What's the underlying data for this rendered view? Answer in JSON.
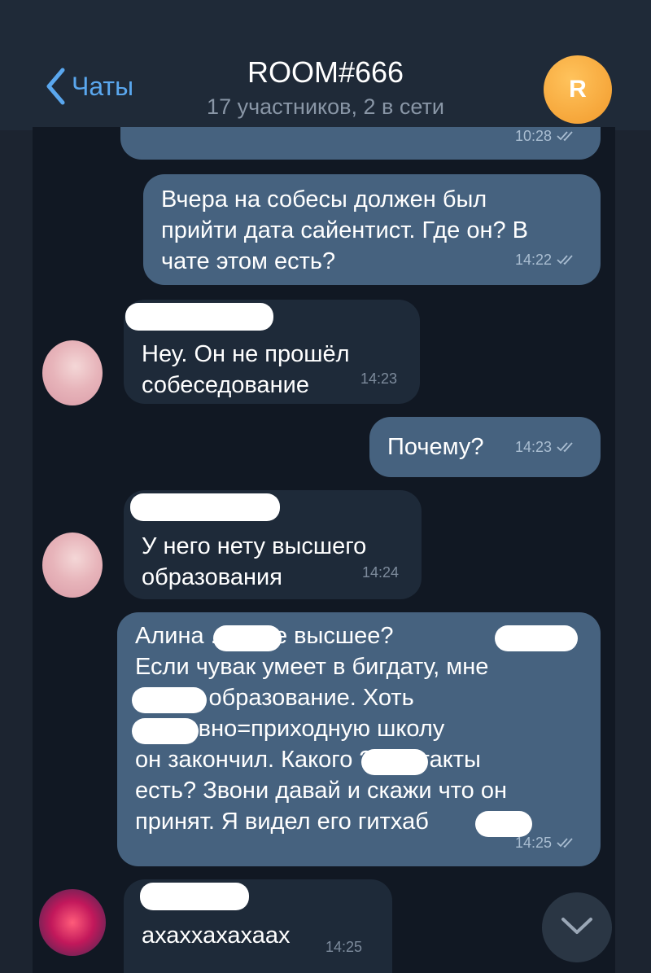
{
  "header": {
    "back_label": "Чаты",
    "title": "ROOM#666",
    "subtitle": "17 участников, 2 в сети",
    "avatar_letter": "R"
  },
  "messages": [
    {
      "direction": "out",
      "text": "",
      "time": "10:28"
    },
    {
      "direction": "out",
      "text": "Вчера на собесы должен был\nприйти дата сайентист. Где он? В\nчате этом есть?",
      "time": "14:22"
    },
    {
      "direction": "in",
      "text": "Неу. Он не прошёл\nсобеседование",
      "time": "14:23"
    },
    {
      "direction": "out",
      "text": "Почему?",
      "time": "14:23"
    },
    {
      "direction": "in",
      "text": "У него нету высшего\nобразования",
      "time": "14:24"
    },
    {
      "direction": "out",
      "text": "Алина          . Какое высшее?\nЕсли чувак умеет в бигдату, мне\n            на его образование. Хоть\n          церковно=приходную школу\nон закончил.  Какого          ? Контакты\nесть? Звони давай и скажи что он\nпринят. Я  видел его гитхаб",
      "time": "14:25"
    },
    {
      "direction": "in",
      "text": "ахаххахахаах",
      "time": "14:25"
    }
  ],
  "colors": {
    "accent": "#5aa7ee",
    "outgoing_bubble": "#46627f",
    "incoming_bubble": "#1e2a39",
    "chat_background": "#111823"
  }
}
